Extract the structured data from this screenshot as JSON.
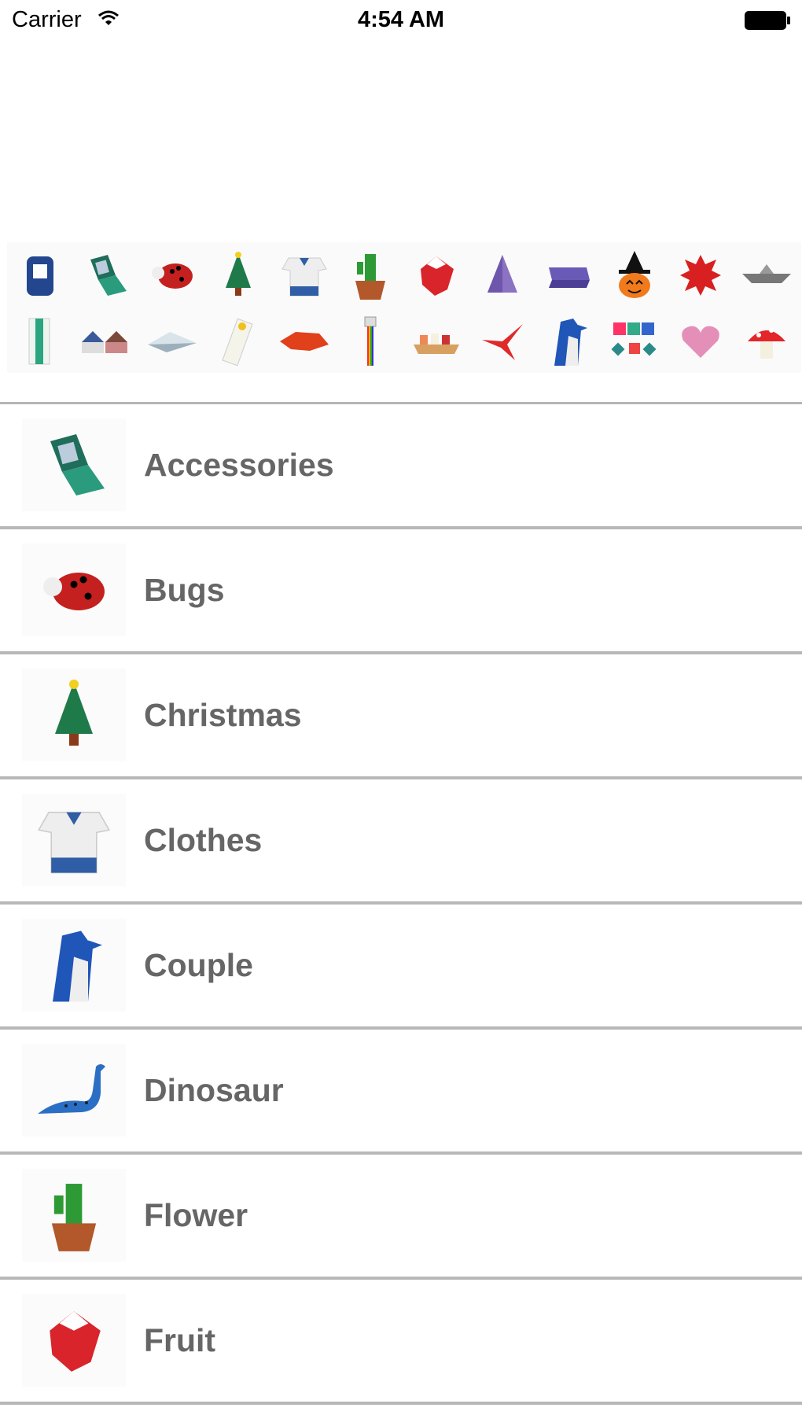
{
  "status_bar": {
    "carrier": "Carrier",
    "time": "4:54 AM",
    "icons": [
      "wifi-icon",
      "battery-icon"
    ]
  },
  "banner": {
    "items": [
      "backpack-icon",
      "phone-icon",
      "ladybug-icon",
      "christmas-tree-icon",
      "shirt-icon",
      "cactus-icon",
      "strawberry-icon",
      "purple-hat-icon",
      "pencil-case-icon",
      "pumpkin-witch-icon",
      "red-star-icon",
      "boat-icon",
      "bookmark-icon",
      "houses-icon",
      "airplane-icon",
      "envelope-icon",
      "fish-icon",
      "pencil-icon",
      "sushi-icon",
      "crane-icon",
      "penguin-icon",
      "frames-icon",
      "heart-icon",
      "mushroom-icon"
    ]
  },
  "categories": [
    {
      "label": "Accessories",
      "icon": "phone-icon"
    },
    {
      "label": "Bugs",
      "icon": "ladybug-icon"
    },
    {
      "label": "Christmas",
      "icon": "christmas-tree-icon"
    },
    {
      "label": "Clothes",
      "icon": "shirt-icon"
    },
    {
      "label": "Couple",
      "icon": "penguin-icon"
    },
    {
      "label": "Dinosaur",
      "icon": "dinosaur-icon"
    },
    {
      "label": "Flower",
      "icon": "cactus-icon"
    },
    {
      "label": "Fruit",
      "icon": "strawberry-icon"
    }
  ],
  "colors": {
    "label_text": "#666666",
    "separator": "#b8b8b8"
  }
}
